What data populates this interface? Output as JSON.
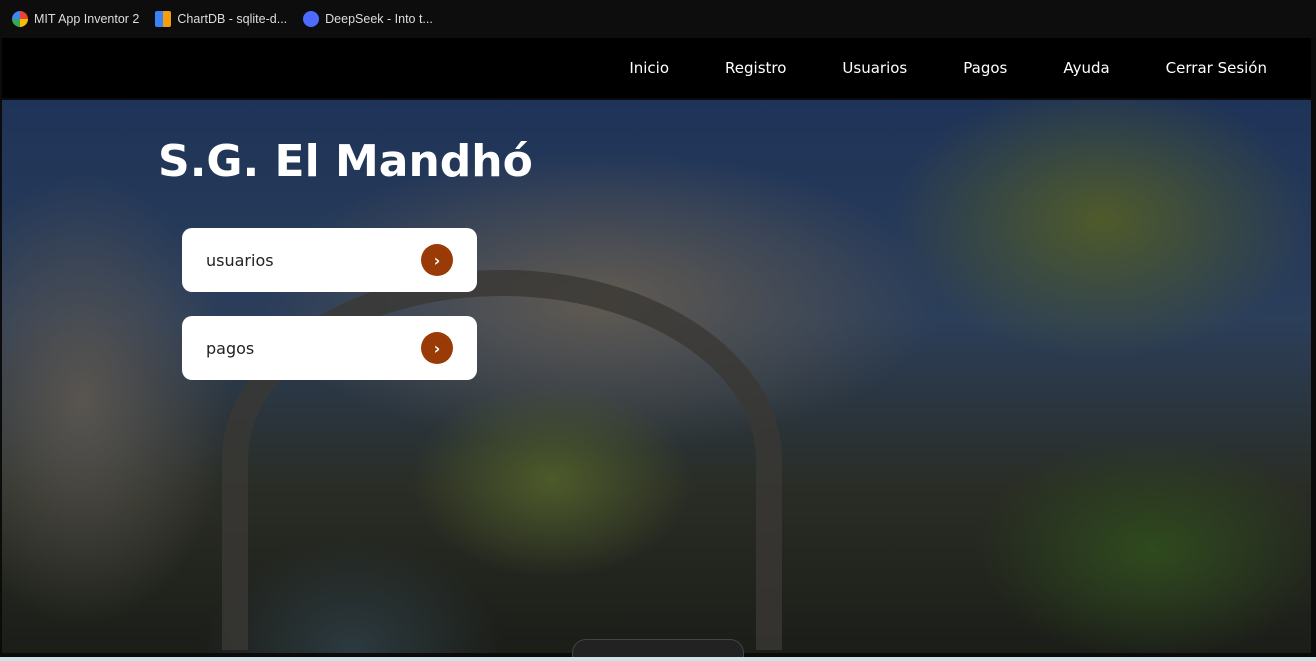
{
  "bookmarks": [
    {
      "label": "MIT App Inventor 2",
      "icon": "google-icon"
    },
    {
      "label": "ChartDB - sqlite-d...",
      "icon": "chartdb-icon"
    },
    {
      "label": "DeepSeek - Into t...",
      "icon": "deepseek-icon"
    }
  ],
  "nav": [
    "Inicio",
    "Registro",
    "Usuarios",
    "Pagos",
    "Ayuda",
    "Cerrar Sesión"
  ],
  "hero": {
    "title": "S.G. El Mandhó",
    "cards": [
      {
        "label": "usuarios",
        "icon": "chevron-right-icon"
      },
      {
        "label": "pagos",
        "icon": "chevron-right-icon"
      }
    ],
    "accent": "#9a3a06"
  }
}
